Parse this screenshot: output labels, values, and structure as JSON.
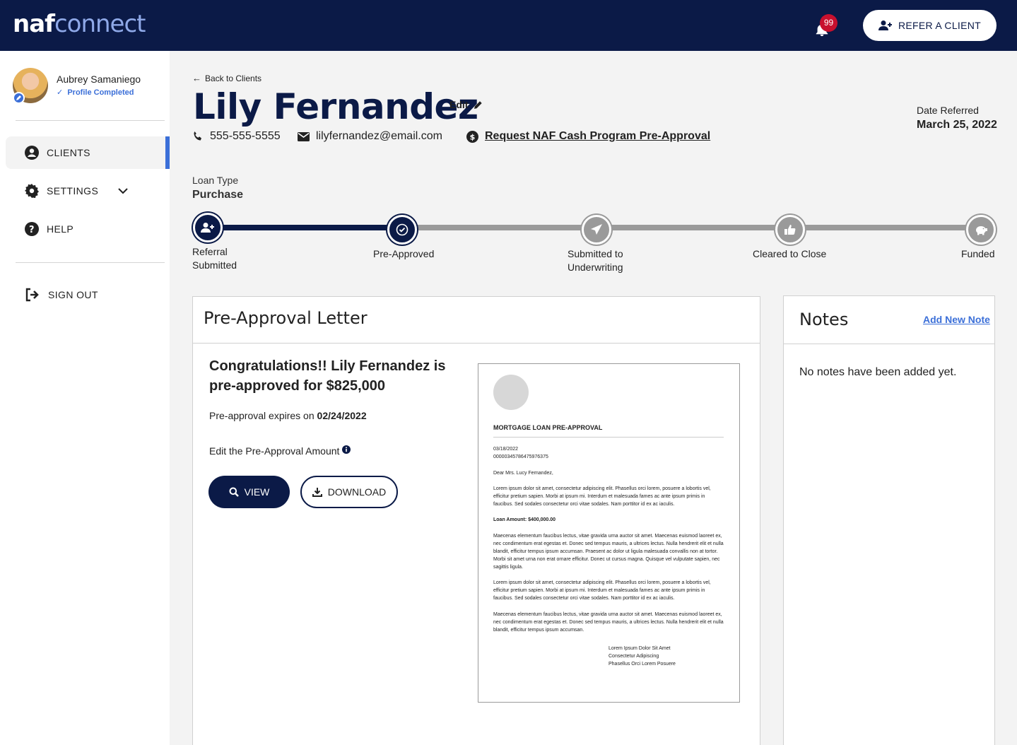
{
  "header": {
    "logo_naf": "naf",
    "logo_connect": "connect",
    "notification_count": "99",
    "refer_button": "REFER A CLIENT"
  },
  "sidebar": {
    "user_name": "Aubrey Samaniego",
    "profile_status": "Profile Completed",
    "items": [
      {
        "label": "CLIENTS",
        "icon": "user-circle-icon",
        "active": true
      },
      {
        "label": "SETTINGS",
        "icon": "gear-icon"
      },
      {
        "label": "HELP",
        "icon": "help-icon"
      }
    ],
    "sign_out": "SIGN OUT"
  },
  "client": {
    "back_label": "Back to Clients",
    "name": "Lily Fernandez",
    "edit_label": "Edit",
    "phone": "555-555-5555",
    "email": "lilyfernandez@email.com",
    "cash_program_link": "Request NAF Cash Program Pre-Approval",
    "date_referred_label": "Date Referred",
    "date_referred": "March 25, 2022",
    "loan_type_label": "Loan Type",
    "loan_type": "Purchase"
  },
  "progress": {
    "steps": [
      {
        "label_line1": "Referral",
        "label_line2": "Submitted",
        "state": "done",
        "icon": "user-plus-icon"
      },
      {
        "label_line1": "Pre-Approved",
        "label_line2": "",
        "state": "done",
        "icon": "check-icon"
      },
      {
        "label_line1": "Submitted to",
        "label_line2": "Underwriting",
        "state": "todo",
        "icon": "paper-plane-icon"
      },
      {
        "label_line1": "Cleared to Close",
        "label_line2": "",
        "state": "todo",
        "icon": "thumbs-up-icon"
      },
      {
        "label_line1": "Funded",
        "label_line2": "",
        "state": "todo",
        "icon": "piggy-bank-icon"
      }
    ]
  },
  "preapproval": {
    "title": "Pre-Approval Letter",
    "congrats": "Congratulations!! Lily Fernandez is pre-approved for $825,000",
    "expires_prefix": "Pre-approval expires on ",
    "expires_date": "02/24/2022",
    "edit_amount": "Edit the Pre-Approval Amount",
    "view_button": "VIEW",
    "download_button": "DOWNLOAD",
    "letter": {
      "heading": "MORTGAGE LOAN PRE-APPROVAL",
      "date": "03/18/2022",
      "ref": "00000345786475976375",
      "salutation": "Dear Mrs. Lucy Fernandez,",
      "para1_l1": "Lorem ipsum dolor sit amet, consectetur adipiscing elit. Phasellus orci lorem, posuere a lobortis vel,",
      "para1_l2": "efficitur pretium sapien. Morbi at ipsum mi. Interdum et malesuada fames ac ante ipsum primis in",
      "para1_l3": "faucibus. Sed sodales consectetur orci vitae sodales. Nam porttitor id ex ac iaculis.",
      "loan_amount": "Loan Amount: $400,000.00",
      "para2_l1": "Maecenas elementum faucibus lectus, vitae gravida urna auctor sit amet. Maecenas euismod laoreet ex,",
      "para2_l2": "nec condimentum erat egestas et. Donec sed tempus mauris, a ultrices lectus. Nulla hendrerit elit et nulla",
      "para2_l3": "blandit, efficitur tempus ipsum accumsan. Praesent ac dolor ut ligula malesuada convallis non at tortor.",
      "para2_l4": "Morbi sit amet urna non erat ornare efficitur. Donec ut cursus magna. Quisque vel vulputate sapien, nec",
      "para2_l5": "sagittis ligula.",
      "para3_l1": "Lorem ipsum dolor sit amet, consectetur adipiscing elit. Phasellus orci lorem, posuere a lobortis vel,",
      "para3_l2": "efficitur pretium sapien. Morbi at ipsum mi. Interdum et malesuada fames ac ante ipsum primis in",
      "para3_l3": "faucibus. Sed sodales consectetur orci vitae sodales. Nam porttitor id ex ac iaculis.",
      "para4_l1": "Maecenas elementum faucibus lectus, vitae gravida urna auctor sit amet. Maecenas euismod laoreet ex,",
      "para4_l2": "nec condimentum erat egestas et. Donec sed tempus mauris, a ultrices lectus. Nulla hendrerit elit et nulla",
      "para4_l3": "blandit, efficitur tempus ipsum accumsan.",
      "sig_l1": "Lorem Ipsum Dolor Sit Amet",
      "sig_l2": "Consectetur Adipiscing",
      "sig_l3": "Phasellus Orci Lorem Posuere"
    }
  },
  "notes": {
    "title": "Notes",
    "add_link": "Add New Note",
    "empty_text": "No notes have been added yet."
  },
  "colors": {
    "navy": "#0b1a47",
    "accent_blue": "#3b6fd8",
    "badge_red": "#c8102e",
    "inactive_gray": "#9a9a9a"
  }
}
